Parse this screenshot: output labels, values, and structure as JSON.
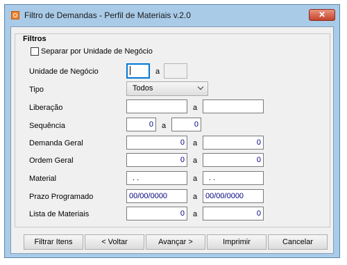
{
  "window": {
    "title": "Filtro de Demandas - Perfil de Materiais v.2.0",
    "close_label": "✕"
  },
  "filters": {
    "group_title": "Filtros",
    "separate_label": "Separar por Unidade de Negócio",
    "unidade": {
      "label": "Unidade de Negócio",
      "sep": "a",
      "from": "",
      "to": ""
    },
    "tipo": {
      "label": "Tipo",
      "value": "Todos"
    },
    "liberacao": {
      "label": "Liberação",
      "sep": "a",
      "from": "",
      "to": ""
    },
    "sequencia": {
      "label": "Sequência",
      "sep": "a",
      "from": "0",
      "to": "0"
    },
    "demanda_geral": {
      "label": "Demanda Geral",
      "sep": "a",
      "from": "0",
      "to": "0"
    },
    "ordem_geral": {
      "label": "Ordem Geral",
      "sep": "a",
      "from": "0",
      "to": "0"
    },
    "material": {
      "label": "Material",
      "sep": "a",
      "from": ". .",
      "to": ". ."
    },
    "prazo": {
      "label": "Prazo Programado",
      "sep": "a",
      "from": "00/00/0000",
      "to": "00/00/0000"
    },
    "lista": {
      "label": "Lista de Materiais",
      "sep": "a",
      "from": "0",
      "to": "0"
    }
  },
  "buttons": {
    "filtrar": "Filtrar Itens",
    "voltar": "< Voltar",
    "avancar": "Avançar >",
    "imprimir": "Imprimir",
    "cancelar": "Cancelar"
  }
}
